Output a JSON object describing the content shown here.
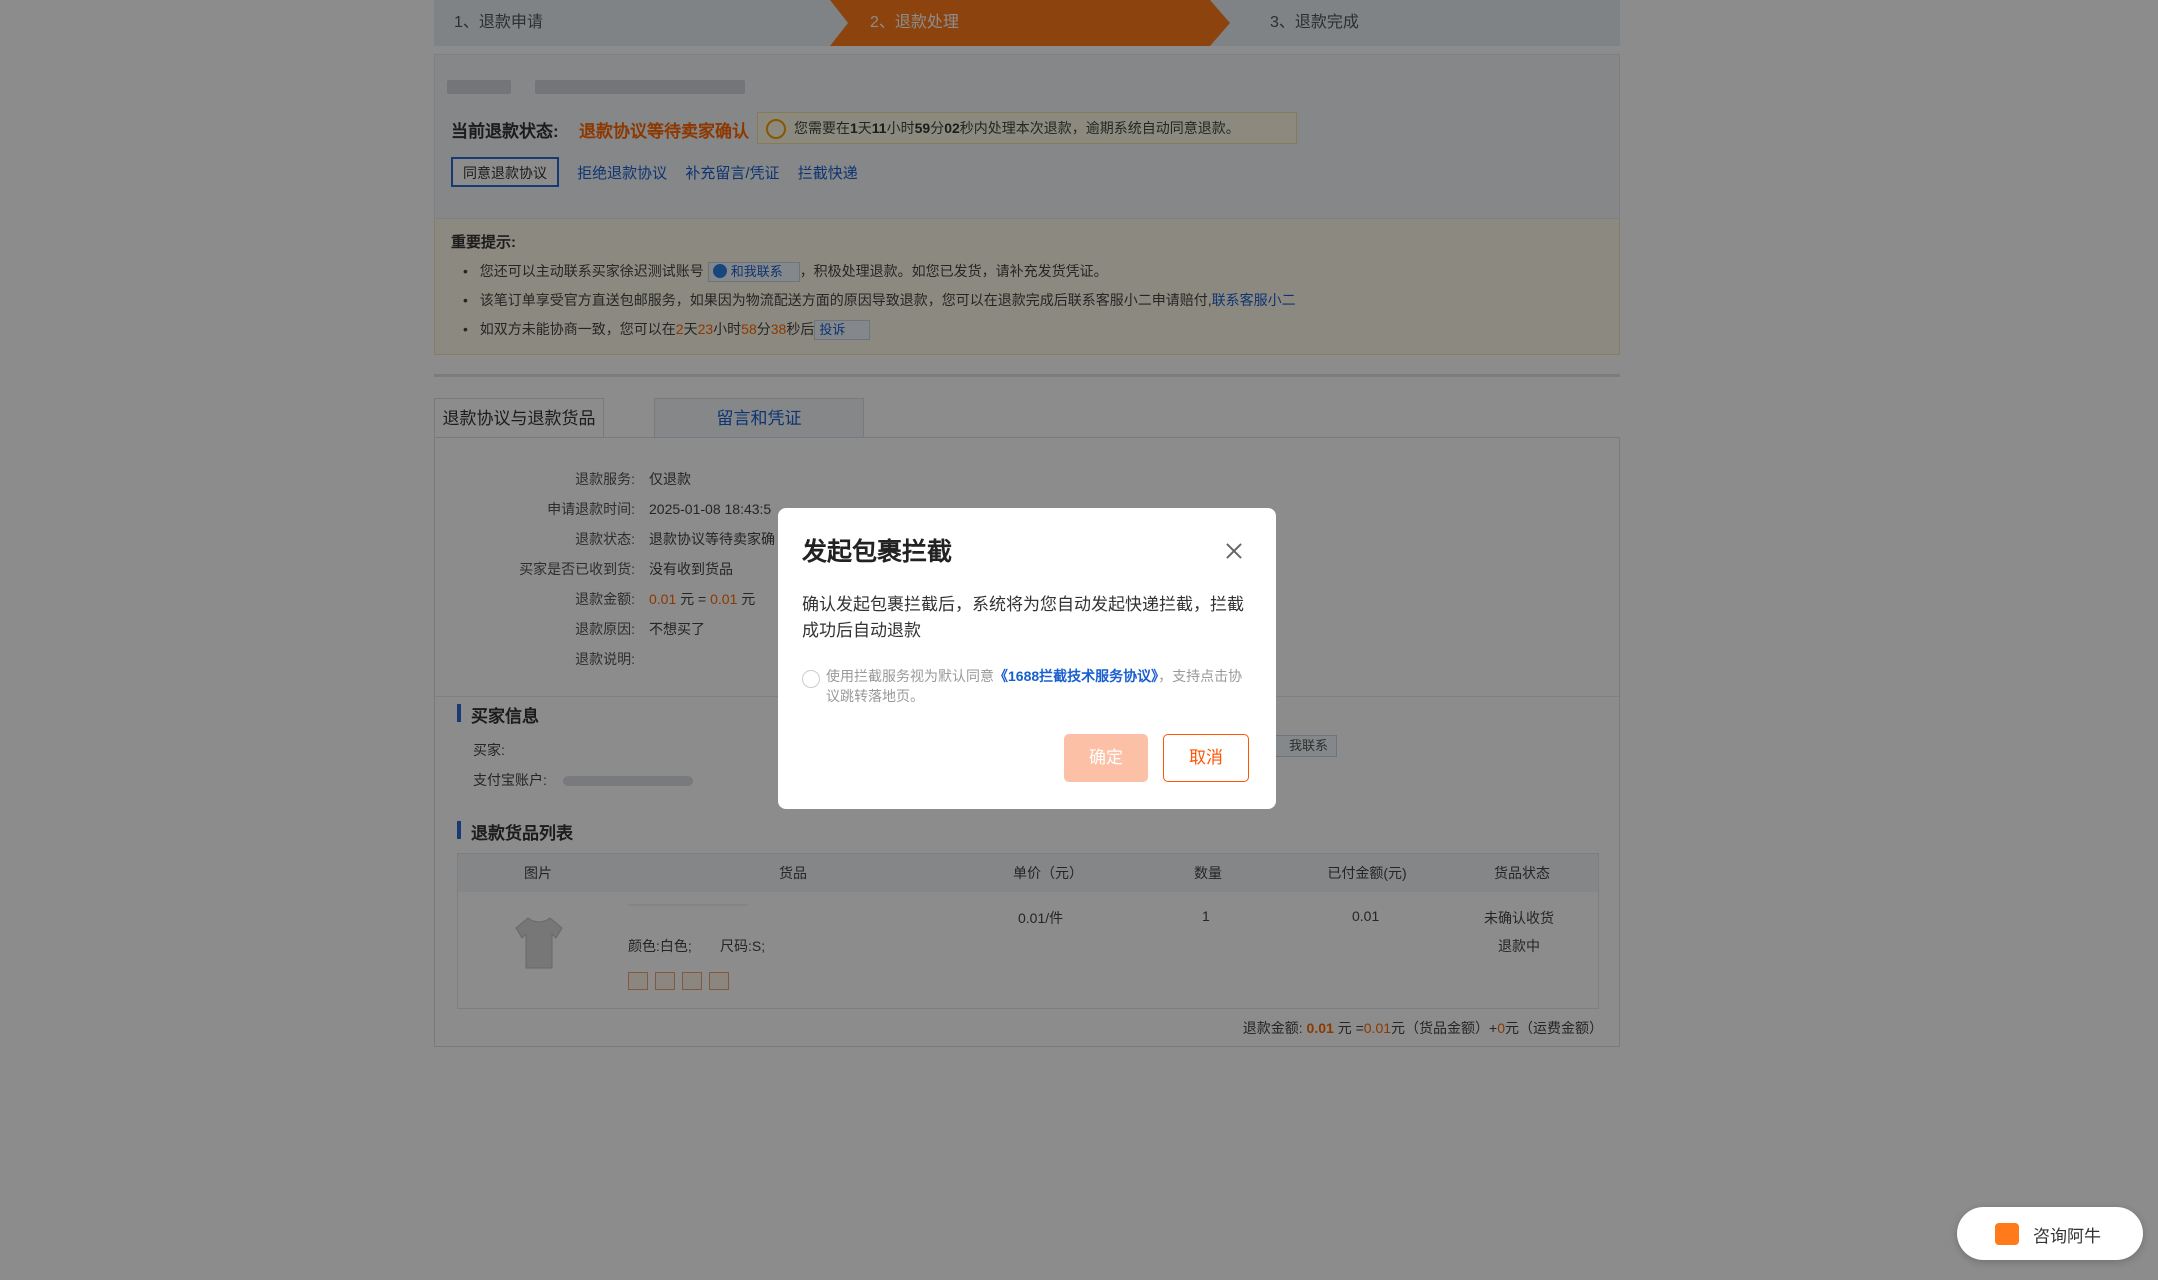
{
  "steps": [
    "1、退款申请",
    "2、退款处理",
    "3、退款完成"
  ],
  "status": {
    "label": "当前退款状态:",
    "value": "退款协议等待卖家确认",
    "timer_prefix": "您需要在",
    "timer_days": "1",
    "timer_d_unit": "天",
    "timer_hours": "11",
    "timer_h_unit": "小时",
    "timer_minutes": "59",
    "timer_m_unit": "分",
    "timer_seconds": "02",
    "timer_suffix": "秒内处理本次退款，逾期系统自动同意退款。"
  },
  "actions": {
    "agree": "同意退款协议",
    "reject": "拒绝退款协议",
    "supplement": "补充留言/凭证",
    "intercept": "拦截快递"
  },
  "notice": {
    "title": "重要提示:",
    "item1_prefix": "您还可以主动联系买家徐迟测试账号",
    "item1_contact": "和我联系",
    "item1_suffix": "，积极处理退款。如您已发货，请补充发货凭证。",
    "item2_text": "该笔订单享受官方直送包邮服务，如果因为物流配送方面的原因导致退款，您可以在退款完成后联系客服小二申请赔付,",
    "item2_link": "联系客服小二",
    "item3_prefix": "如双方未能协商一致，您可以在",
    "item3_days": "2",
    "item3_d_unit": "天",
    "item3_hours": "23",
    "item3_h_unit": "小时",
    "item3_minutes": "58",
    "item3_m_unit": "分",
    "item3_seconds": "38",
    "item3_suffix": "秒后",
    "item3_btn": "投诉"
  },
  "tabs": [
    "退款协议与退款货品",
    "留言和凭证"
  ],
  "refund_info": [
    {
      "key": "退款服务:",
      "value": "仅退款"
    },
    {
      "key": "申请退款时间:",
      "value": "2025-01-08 18:43:5"
    },
    {
      "key": "退款状态:",
      "value": "退款协议等待卖家确"
    },
    {
      "key": "买家是否已收到货:",
      "value": "没有收到货品"
    },
    {
      "key": "退款金额:",
      "value_amount": "0.01",
      "value_unit": "元 = ",
      "value_amount2": "0.01",
      "value_unit2": "元"
    },
    {
      "key": "退款原因:",
      "value": "不想买了"
    },
    {
      "key": "退款说明:",
      "value": ""
    }
  ],
  "buyer": {
    "title": "买家信息",
    "buyer_label": "买家:",
    "alipay_label": "支付宝账户:",
    "contact_chip": "我联系"
  },
  "goods": {
    "title": "退款货品列表",
    "headers": [
      "图片",
      "货品",
      "单价（元）",
      "数量",
      "已付金额(元)",
      "货品状态"
    ],
    "row": {
      "spec_color": "颜色:白色;",
      "spec_size": "尺码:S;",
      "price": "0.01/件",
      "qty": "1",
      "paid": "0.01",
      "status1": "未确认收货",
      "status2": "退款中"
    },
    "total_label": "退款金额:",
    "total_amount": "0.01",
    "total_unit": "元 =",
    "goods_amount": "0.01",
    "goods_unit": "元（货品金额）+",
    "ship_amount": "0",
    "ship_unit": "元（运费金额）"
  },
  "modal": {
    "title": "发起包裹拦截",
    "text": "确认发起包裹拦截后，系统将为您自动发起快递拦截，拦截成功后自动退款",
    "agree_prefix": "使用拦截服务视为默认同意",
    "agree_link": "《1688拦截技术服务协议》",
    "agree_suffix": "，支持点击协议跳转落地页。",
    "ok": "确定",
    "cancel": "取消"
  },
  "consult": {
    "label": "咨询阿牛"
  },
  "colors": {
    "accent": "#ff7a1a",
    "link": "#1a5fd0",
    "warning": "#ff6600",
    "ok_disabled": "#fcc0a6"
  }
}
